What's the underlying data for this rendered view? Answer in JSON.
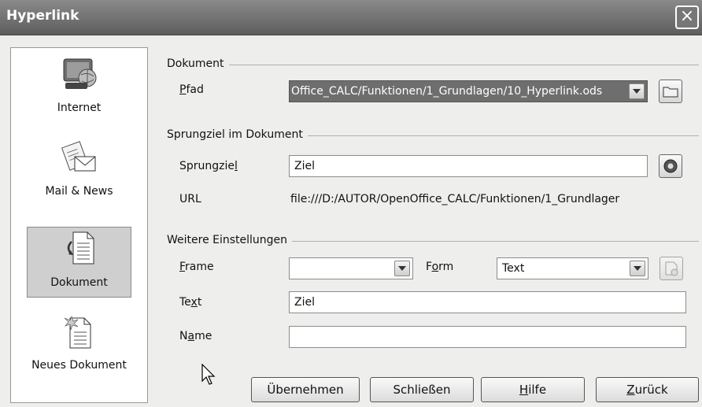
{
  "window": {
    "title": "Hyperlink",
    "close_icon": "×"
  },
  "sidebar": {
    "items": [
      {
        "label": "Internet",
        "icon": "internet-icon",
        "selected": false
      },
      {
        "label": "Mail & News",
        "icon": "mail-news-icon",
        "selected": false
      },
      {
        "label": "Dokument",
        "icon": "document-icon",
        "selected": true
      },
      {
        "label": "Neues Dokument",
        "icon": "new-document-icon",
        "selected": false
      }
    ]
  },
  "dokument": {
    "group_title": "Dokument",
    "pfad_label_rest": "fad",
    "pfad_label_accel": "P",
    "pfad_value": "Office_CALC/Funktionen/1_Grundlagen/10_Hyperlink.ods"
  },
  "sprungziel": {
    "group_title": "Sprungziel im Dokument",
    "label_main": "Sprungzie",
    "label_accel": "l",
    "value": "Ziel",
    "url_label": "URL",
    "url_value": "file:///D:/AUTOR/OpenOffice_CALC/Funktionen/1_Grundlager"
  },
  "weitere": {
    "group_title": "Weitere Einstellungen",
    "frame_accel": "F",
    "frame_rest": "rame",
    "frame_value": "",
    "form_pre": "F",
    "form_accel": "o",
    "form_rest": "rm",
    "form_value": "Text",
    "text_pre": "Te",
    "text_accel": "x",
    "text_rest": "t",
    "text_value": "Ziel",
    "name_pre": "N",
    "name_accel": "a",
    "name_rest": "me",
    "name_value": ""
  },
  "buttons": {
    "apply": "Übernehmen",
    "close": "Schließen",
    "help_accel": "H",
    "help_rest": "ilfe",
    "back_accel": "Z",
    "back_rest": "urück"
  }
}
